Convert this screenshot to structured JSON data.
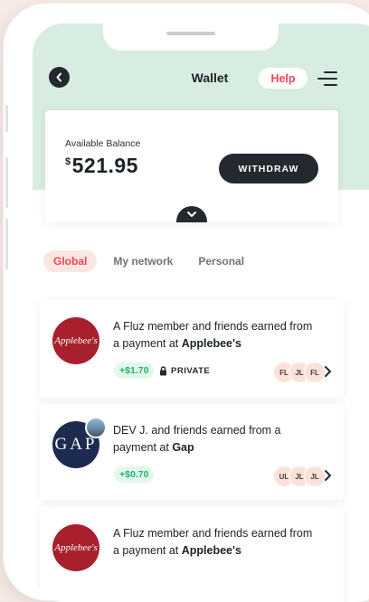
{
  "header": {
    "title": "Wallet",
    "help_label": "Help"
  },
  "balance": {
    "label": "Available Balance",
    "currency_symbol": "$",
    "amount": "521.95",
    "withdraw_label": "WITHDRAW"
  },
  "tabs": [
    {
      "label": "Global",
      "active": true
    },
    {
      "label": "My network",
      "active": false
    },
    {
      "label": "Personal",
      "active": false
    }
  ],
  "feed": [
    {
      "logo_text": "Applebee's",
      "text_prefix": "A Fluz member and friends earned from a payment at ",
      "merchant": "Applebee's",
      "earning": "+$1.70",
      "privacy": "PRIVATE",
      "avatars": [
        "FL",
        "JL",
        "FL"
      ]
    },
    {
      "logo_text": "GAP",
      "text_prefix": "DEV J. and friends earned from a payment at ",
      "merchant": "Gap",
      "earning": "+$0.70",
      "privacy": "",
      "avatars": [
        "UL",
        "JL",
        "JL"
      ]
    },
    {
      "logo_text": "Applebee's",
      "text_prefix": "A Fluz member and friends earned from a payment at ",
      "merchant": "Applebee's"
    }
  ],
  "colors": {
    "accent": "#f2455a",
    "header_bg": "#d7ede1",
    "earn_green": "#1fb36a",
    "dark": "#23292e"
  },
  "icons": {
    "back": "chevron-left-icon",
    "menu": "menu-icon",
    "expand": "chevron-down-icon",
    "privacy": "lock-icon",
    "more": "chevron-right-icon"
  }
}
